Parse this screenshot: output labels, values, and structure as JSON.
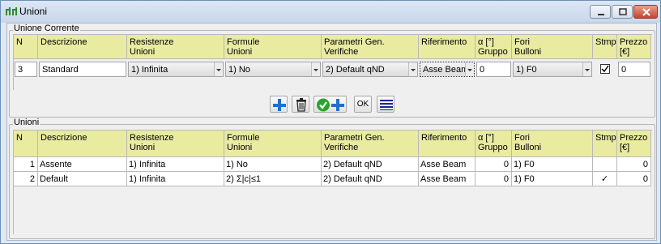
{
  "window": {
    "title": "Unioni"
  },
  "current": {
    "group_label": "Unione Corrente",
    "row": {
      "n": "3",
      "descrizione": "Standard",
      "resistenze": "1) Infinita",
      "formule": "1) No",
      "parametri": "2) Default qND",
      "riferimento": "Asse Beam",
      "gruppo": "0",
      "fori": "1) F0",
      "stmp": true,
      "prezzo": "0"
    },
    "toolbar": {
      "ok_label": "OK"
    }
  },
  "list": {
    "group_label": "Unioni",
    "rows": [
      {
        "n": "1",
        "descrizione": "Assente",
        "resistenze": "1) Infinita",
        "formule": "1) No",
        "parametri": "2) Default qND",
        "riferimento": "Asse Beam",
        "gruppo": "0",
        "fori": "1) F0",
        "stmp": "",
        "prezzo": "0"
      },
      {
        "n": "2",
        "descrizione": "Default",
        "resistenze": "1) Infinita",
        "formule": "2) Σ|c|≤1",
        "parametri": "2) Default qND",
        "riferimento": "Asse Beam",
        "gruppo": "0",
        "fori": "1) F0",
        "stmp": "✓",
        "prezzo": "0"
      }
    ]
  },
  "columns": [
    {
      "line1": "N",
      "line2": ""
    },
    {
      "line1": "Descrizione",
      "line2": ""
    },
    {
      "line1": "Resistenze",
      "line2": "Unioni"
    },
    {
      "line1": "Formule",
      "line2": "Unioni"
    },
    {
      "line1": "Parametri Gen.",
      "line2": "Verifiche"
    },
    {
      "line1": "Riferimento",
      "line2": ""
    },
    {
      "line1": "α [°]",
      "line2": "Gruppo"
    },
    {
      "line1": "Fori",
      "line2": "Bulloni"
    },
    {
      "line1": "Stmp",
      "line2": ""
    },
    {
      "line1": "Prezzo",
      "line2": "[€]"
    }
  ],
  "colors": {
    "header_bg": "#e8eba0",
    "titlebar": "#c7d7eb",
    "accent_plus": "#1f6fd1",
    "accent_check": "#2aa52a"
  }
}
